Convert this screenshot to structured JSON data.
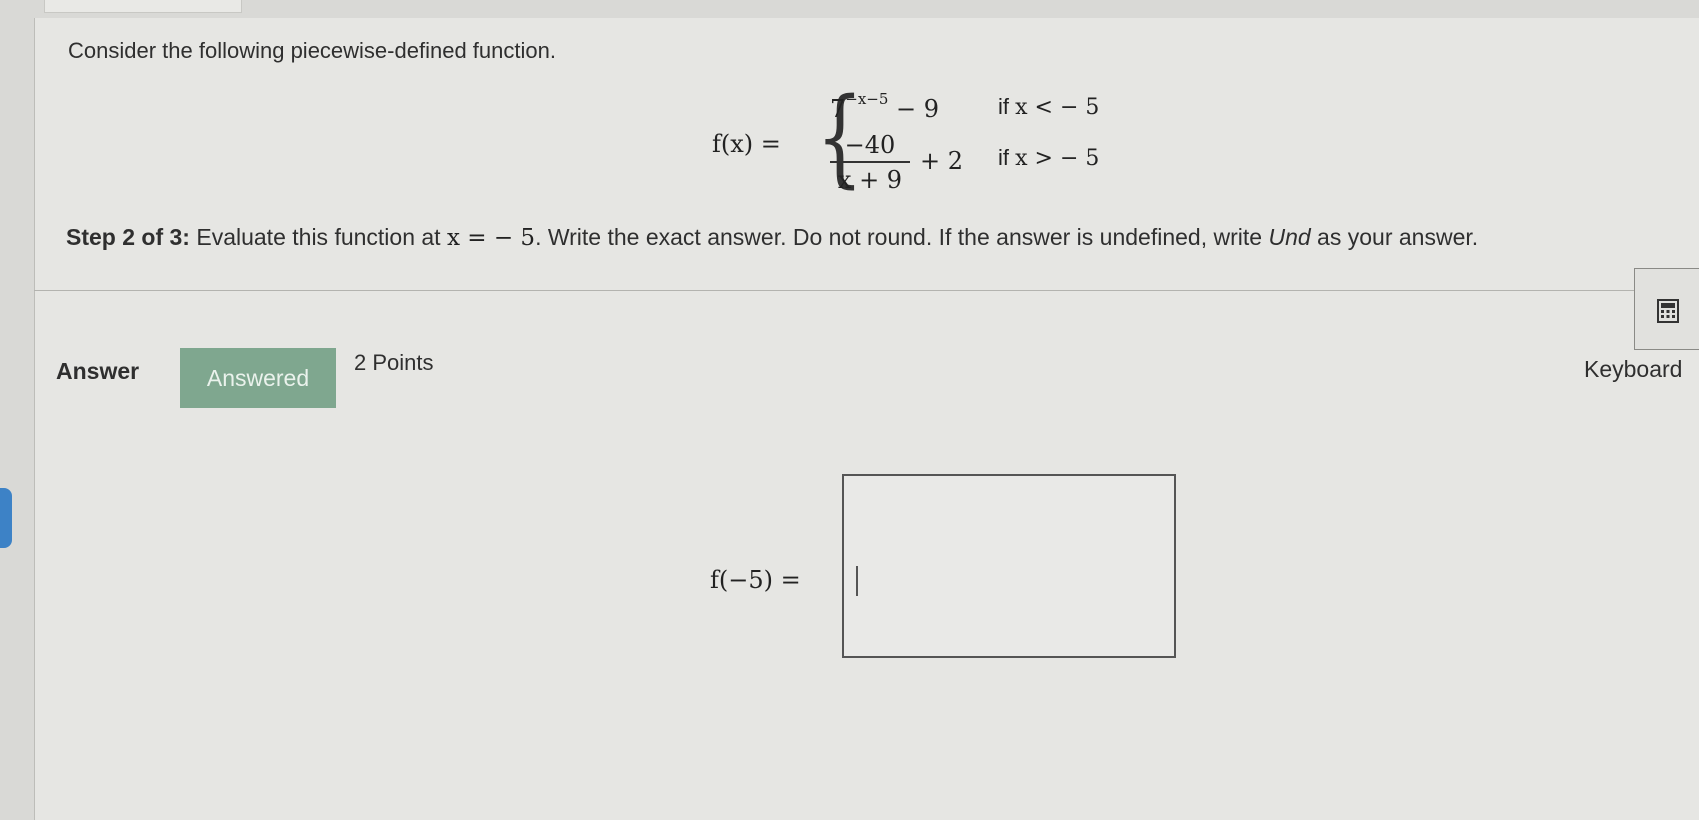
{
  "problem": {
    "intro": "Consider the following piecewise-defined function.",
    "function_label": "f(x) =",
    "case1_base": "7",
    "case1_exponent": "−x−5",
    "case1_rest": " − 9",
    "case1_condition_if": "if ",
    "case1_condition": "x < − 5",
    "case2_numerator": "−40",
    "case2_denominator": "x + 9",
    "case2_rest": "+ 2",
    "case2_condition_if": "if ",
    "case2_condition": "x > − 5"
  },
  "step": {
    "prefix": "Step 2 of 3:",
    "text_before": " Evaluate this function at ",
    "math": "x =  − 5",
    "text_after": ". Write the exact answer. Do not round. If the answer is undefined, write ",
    "und": "Und",
    "text_end": " as your answer."
  },
  "answer": {
    "label": "Answer",
    "badge": "Answered",
    "points": "2 Points",
    "keyboard_label": "Keyboard",
    "keyboard_icon": "calculator-icon",
    "eval_label": "f(−5) =",
    "input_value": ""
  },
  "colors": {
    "badge_bg": "#7fa78f",
    "background": "#e6e6e3",
    "side_tab": "#3d82c6"
  }
}
